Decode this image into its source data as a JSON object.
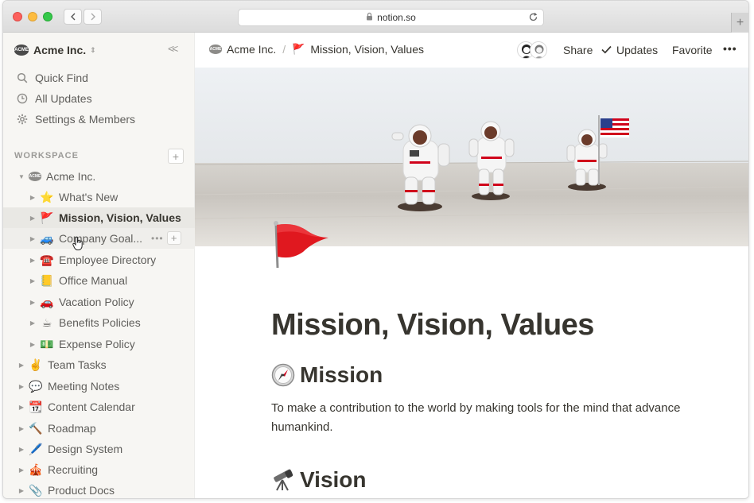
{
  "browser": {
    "url": "notion.so"
  },
  "sidebar": {
    "workspace_name": "Acme Inc.",
    "workspace_logo_text": "ACME",
    "quick_links": [
      {
        "label": "Quick Find",
        "icon": "search-icon"
      },
      {
        "label": "All Updates",
        "icon": "clock-icon"
      },
      {
        "label": "Settings & Members",
        "icon": "gear-icon"
      }
    ],
    "section_label": "WORKSPACE",
    "tree": [
      {
        "label": "Acme Inc.",
        "emoji": "",
        "level": 0,
        "expanded": true
      },
      {
        "label": "What's New",
        "emoji": "⭐",
        "level": 1
      },
      {
        "label": "Mission, Vision, Values",
        "emoji": "🚩",
        "level": 1,
        "active": true
      },
      {
        "label": "Company Goal...",
        "emoji": "🚙",
        "level": 1,
        "hover": true
      },
      {
        "label": "Employee Directory",
        "emoji": "☎️",
        "level": 1
      },
      {
        "label": "Office Manual",
        "emoji": "📒",
        "level": 1
      },
      {
        "label": "Vacation Policy",
        "emoji": "🚗",
        "level": 1
      },
      {
        "label": "Benefits Policies",
        "emoji": "☕",
        "level": 1
      },
      {
        "label": "Expense Policy",
        "emoji": "💵",
        "level": 1
      },
      {
        "label": "Team Tasks",
        "emoji": "✌️",
        "level": 0
      },
      {
        "label": "Meeting Notes",
        "emoji": "💬",
        "level": 0
      },
      {
        "label": "Content Calendar",
        "emoji": "📆",
        "level": 0
      },
      {
        "label": "Roadmap",
        "emoji": "🔨",
        "level": 0
      },
      {
        "label": "Design System",
        "emoji": "🖊️",
        "level": 0
      },
      {
        "label": "Recruiting",
        "emoji": "🎪",
        "level": 0
      },
      {
        "label": "Product Docs",
        "emoji": "📎",
        "level": 0
      }
    ]
  },
  "topbar": {
    "breadcrumb_workspace": "Acme Inc.",
    "breadcrumb_separator": "/",
    "breadcrumb_page": "Mission, Vision, Values",
    "share": "Share",
    "updates": "Updates",
    "favorite": "Favorite",
    "more": "•••"
  },
  "page": {
    "title": "Mission, Vision, Values",
    "mission_heading": "Mission",
    "mission_text": "To make a contribution to the world by making tools for the mind that advance humankind.",
    "vision_heading": "Vision"
  },
  "colors": {
    "sidebar_bg": "#f7f6f3",
    "text": "#37352f",
    "active_row": "#e9e8e4",
    "flag_red": "#d0021b"
  }
}
